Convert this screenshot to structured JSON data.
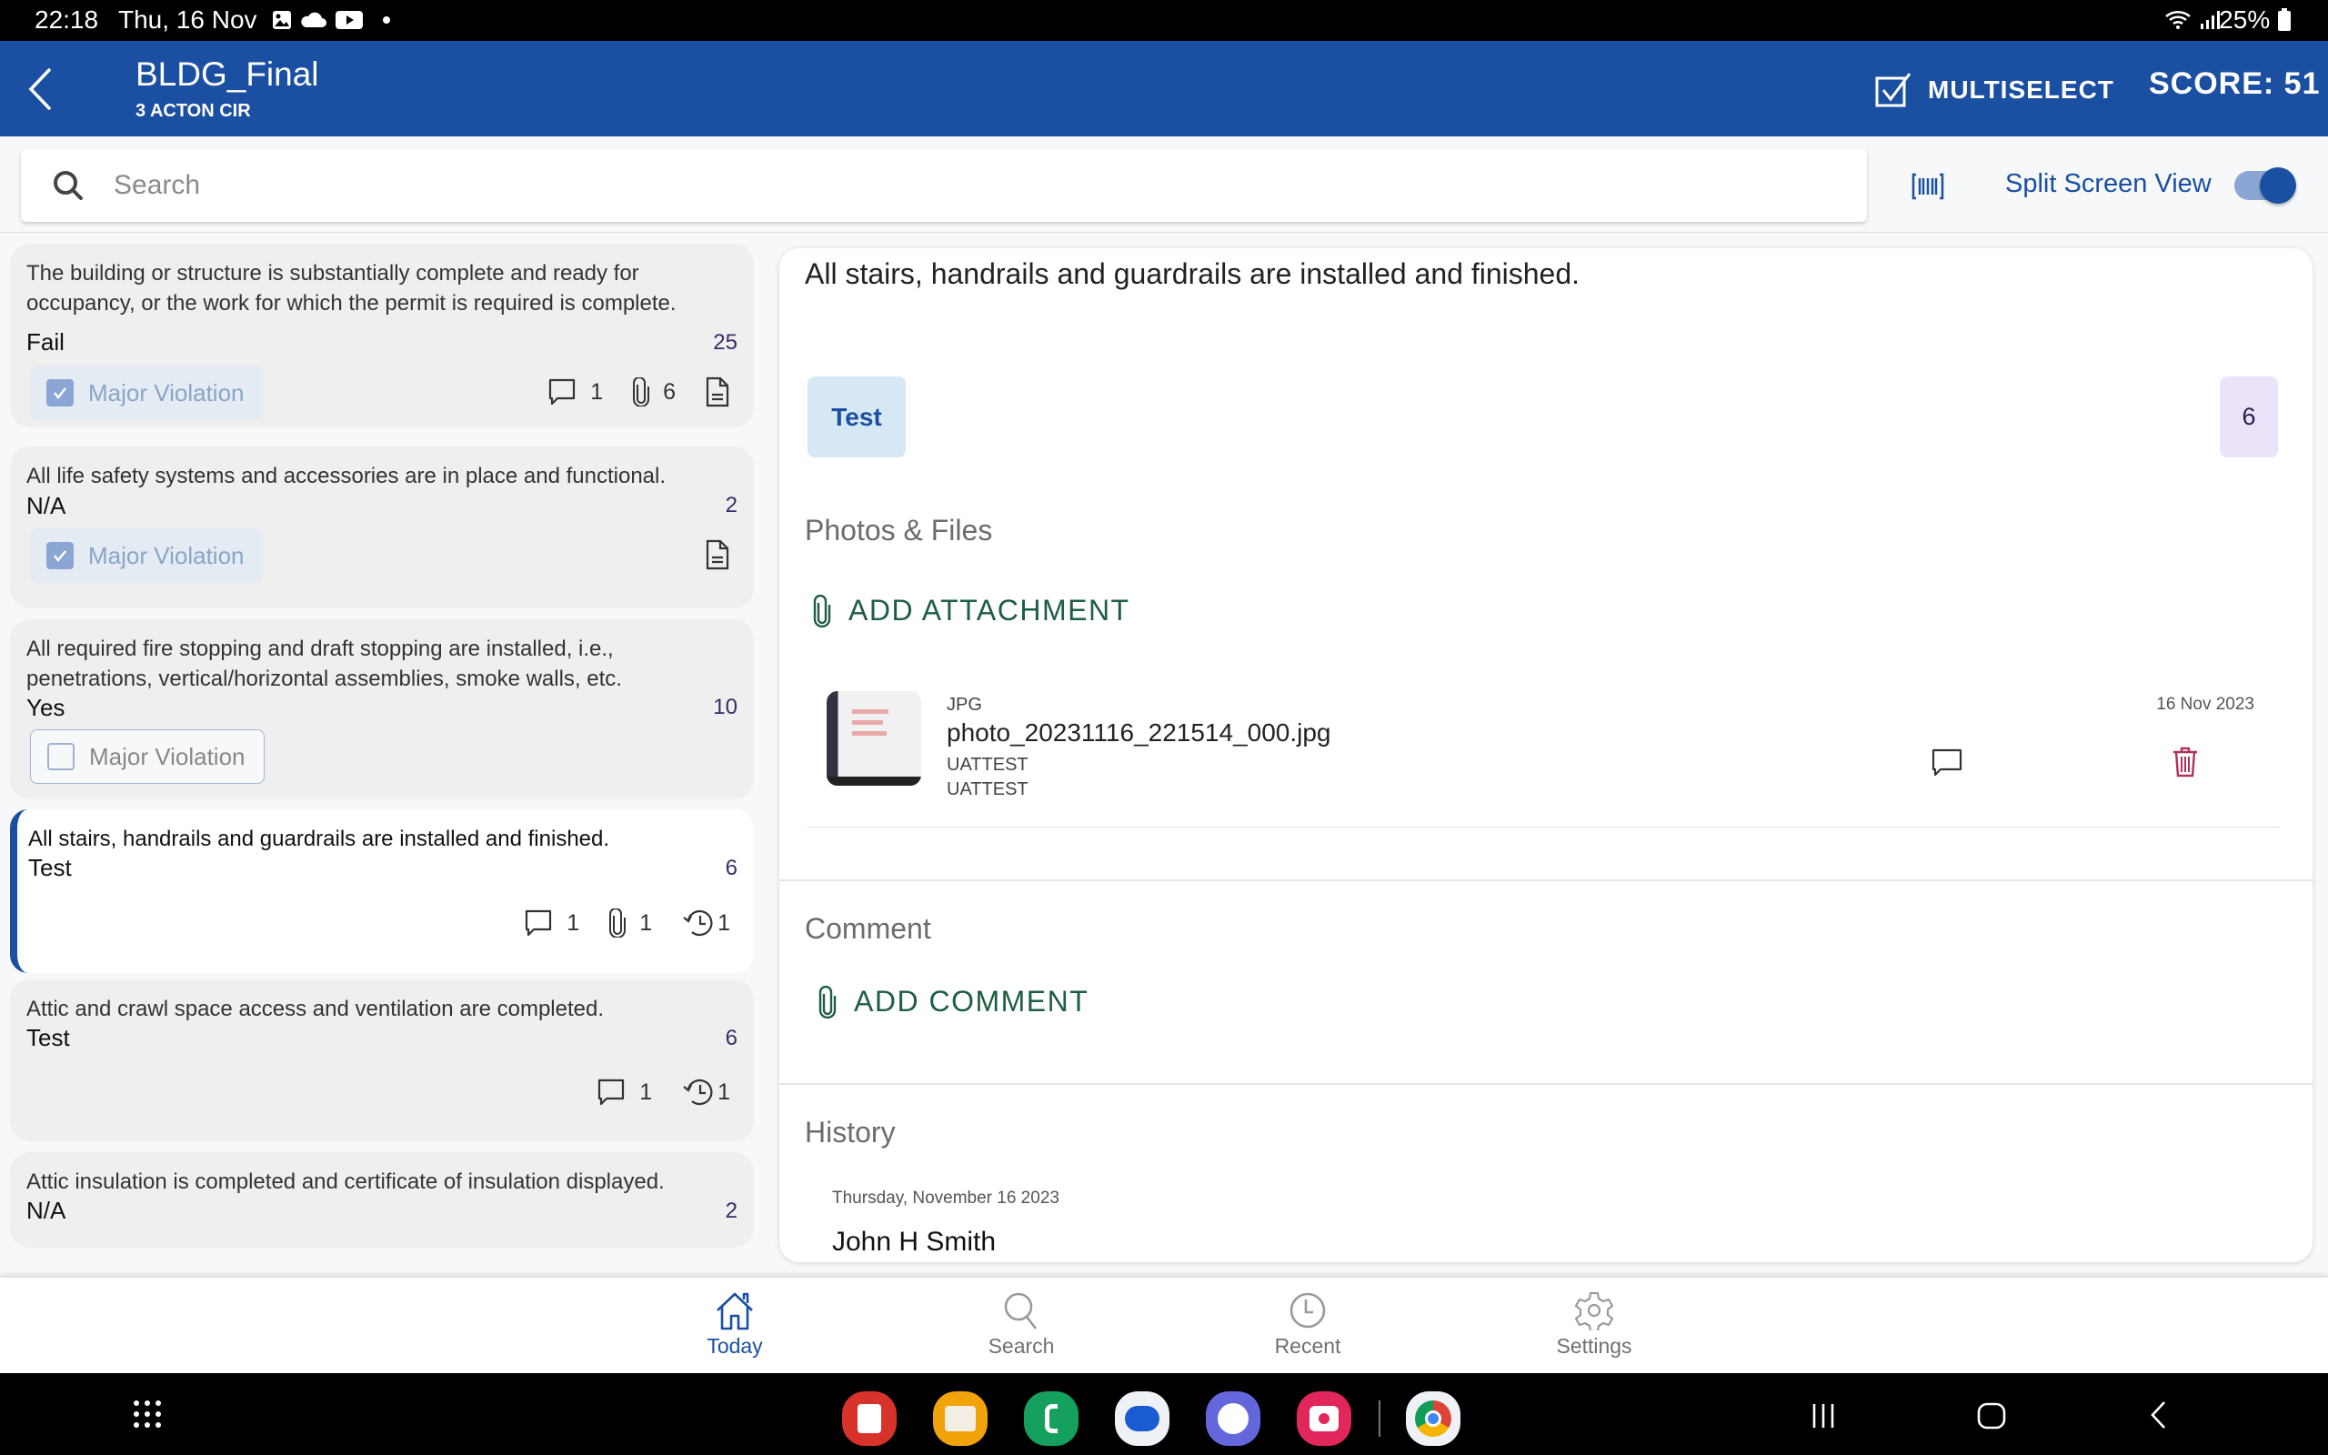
{
  "status_bar": {
    "time": "22:18",
    "date": "Thu, 16 Nov",
    "notification_icons": [
      "gallery-icon",
      "cloud-icon",
      "youtube-icon",
      "dot-icon"
    ],
    "battery": "25%",
    "right_icons": [
      "wifi-icon",
      "signal-icon",
      "battery-icon"
    ]
  },
  "app_bar": {
    "title": "BLDG_Final",
    "subtitle": "3 ACTON CIR",
    "multiselect_label": "MULTISELECT",
    "score_label": "SCORE: 51",
    "color": "#1b4fa2"
  },
  "search": {
    "placeholder": "Search",
    "value": "",
    "split_screen_label": "Split Screen View",
    "split_screen_on": true
  },
  "checklist": [
    {
      "question": "The building or structure is substantially complete and ready for occupancy, or the work for which the permit is required is complete.",
      "answer": "Fail",
      "points": "25",
      "violation_label": "Major Violation",
      "violation_checked": true,
      "comments": "1",
      "attachments": "6",
      "history": null,
      "has_document_icon": true,
      "selected": false
    },
    {
      "question": "All life safety systems and accessories are in place and functional.",
      "answer": "N/A",
      "points": "2",
      "violation_label": "Major Violation",
      "violation_checked": true,
      "comments": null,
      "attachments": null,
      "history": null,
      "has_document_icon": true,
      "selected": false
    },
    {
      "question": "All required fire stopping and draft stopping are installed, i.e., penetrations, vertical/horizontal assemblies, smoke walls, etc.",
      "answer": "Yes",
      "points": "10",
      "violation_label": "Major Violation",
      "violation_checked": false,
      "selected": false
    },
    {
      "question": "All stairs, handrails and guardrails are installed and finished.",
      "answer": "Test",
      "points": "6",
      "comments": "1",
      "attachments": "1",
      "history": "1",
      "selected": true
    },
    {
      "question": "Attic and crawl space access and ventilation are completed.",
      "answer": "Test",
      "points": "6",
      "comments": "1",
      "history": "1",
      "selected": false
    },
    {
      "question": "Attic insulation is completed and certificate of insulation displayed.",
      "answer": "N/A",
      "points": "2",
      "selected": false
    }
  ],
  "detail": {
    "question": "All stairs, handrails and guardrails are installed and finished.",
    "answer_button": "Test",
    "points": "6",
    "photos_heading": "Photos & Files",
    "add_attachment_label": "ADD ATTACHMENT",
    "files": [
      {
        "type": "JPG",
        "name": "photo_20231116_221514_000.jpg",
        "uploaded_by": "UATTEST",
        "owner": "UATTEST",
        "date": "16 Nov 2023"
      }
    ],
    "comment_heading": "Comment",
    "add_comment_label": "ADD COMMENT",
    "history_heading": "History",
    "history": [
      {
        "date": "Thursday, November 16 2023",
        "user": "John H Smith"
      }
    ],
    "accent_green": "#1e5e42",
    "delete_color": "#b0345a"
  },
  "bottom_nav": {
    "items": [
      {
        "label": "Today",
        "icon": "home-icon",
        "active": true
      },
      {
        "label": "Search",
        "icon": "search-icon",
        "active": false
      },
      {
        "label": "Recent",
        "icon": "clock-icon",
        "active": false
      },
      {
        "label": "Settings",
        "icon": "gear-icon",
        "active": false
      }
    ]
  },
  "system_nav": {
    "dock_apps": [
      "notes-app",
      "files-app",
      "phone-app",
      "messages-app",
      "internet-app",
      "camera-app",
      "chrome-app"
    ],
    "buttons": [
      "recents-button",
      "home-button",
      "back-button"
    ]
  }
}
